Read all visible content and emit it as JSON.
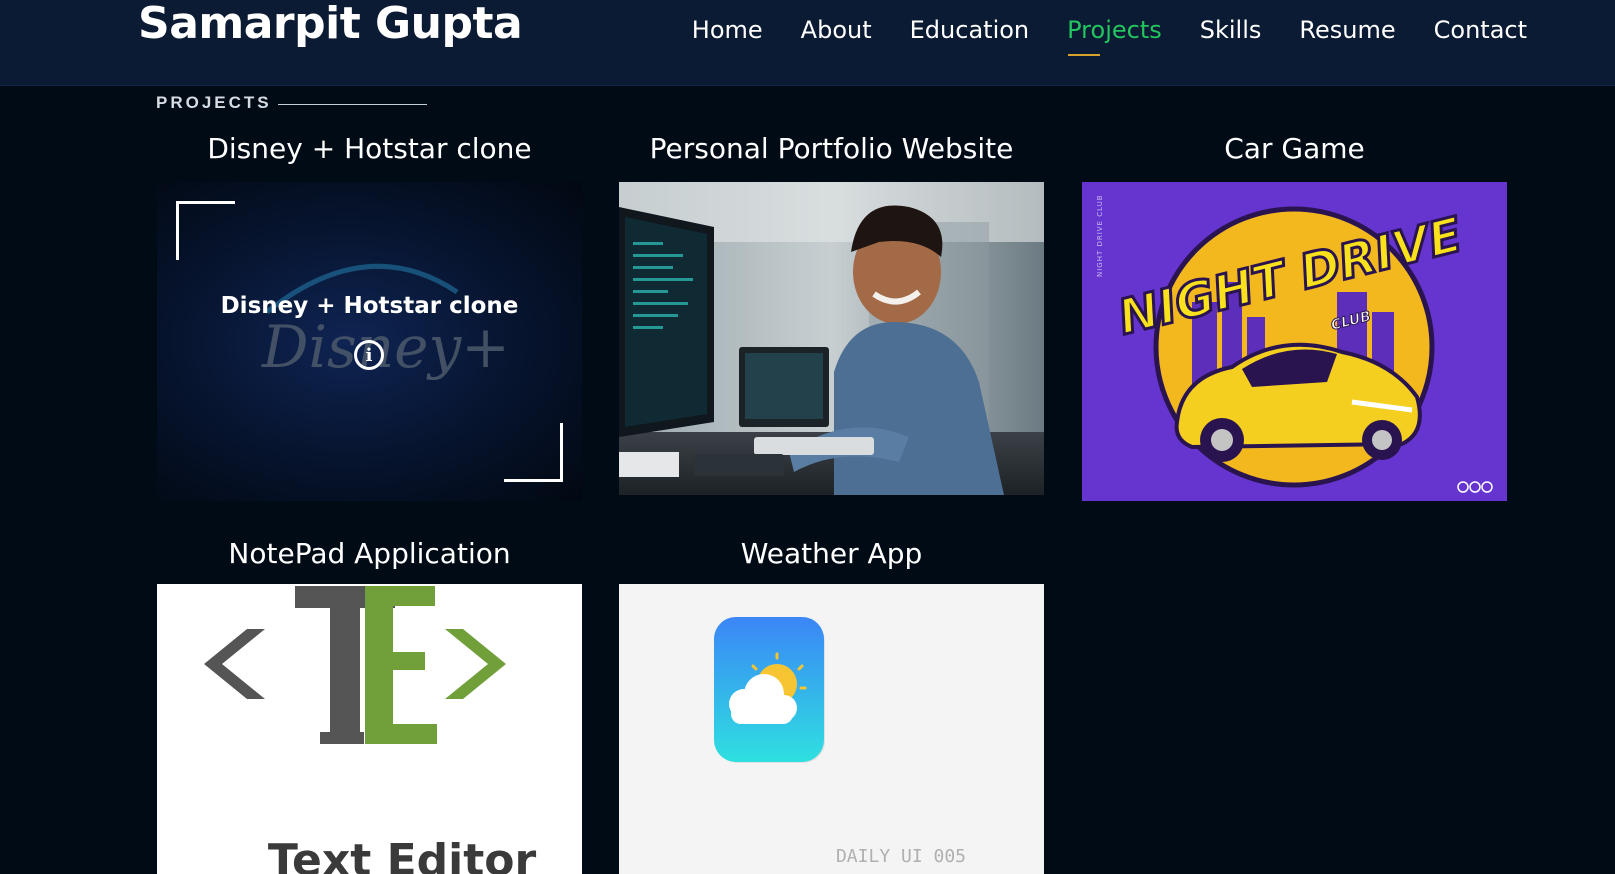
{
  "header": {
    "brand": "Samarpit Gupta",
    "nav": [
      {
        "label": "Home",
        "active": false
      },
      {
        "label": "About",
        "active": false
      },
      {
        "label": "Education",
        "active": false
      },
      {
        "label": "Projects",
        "active": true
      },
      {
        "label": "Skills",
        "active": false
      },
      {
        "label": "Resume",
        "active": false
      },
      {
        "label": "Contact",
        "active": false
      }
    ],
    "active_color": "#22c55e",
    "underline_color": "#d6a229"
  },
  "section": {
    "label": "PROJECTS"
  },
  "projects": [
    {
      "title": "Disney + Hotstar clone",
      "overlay_title": "Disney + Hotstar clone",
      "image_text": "Disney+",
      "icon": "info-icon"
    },
    {
      "title": "Personal Portfolio Website"
    },
    {
      "title": "Car Game",
      "image_text_main": "NIGHT DRIVE",
      "image_text_sub": "CLUB",
      "image_text_side": "NIGHT DRIVE CLUB"
    },
    {
      "title": "NotePad Application",
      "image_text": "Text Editor"
    },
    {
      "title": "Weather App",
      "image_text": "DAILY UI 005"
    }
  ]
}
